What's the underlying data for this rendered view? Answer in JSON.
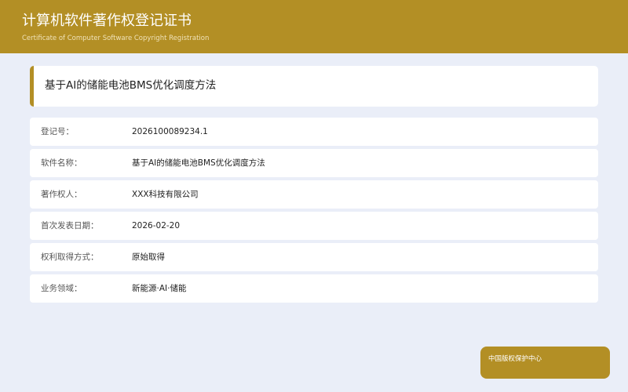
{
  "header": {
    "title": "计算机软件著作权登记证书",
    "subtitle": "Certificate of Computer Software Copyright Registration"
  },
  "document": {
    "title": "基于AI的储能电池BMS优化调度方法"
  },
  "fields": [
    {
      "label": "登记号：",
      "value": "2026100089234.1"
    },
    {
      "label": "软件名称：",
      "value": "基于AI的储能电池BMS优化调度方法"
    },
    {
      "label": "著作权人：",
      "value": "XXX科技有限公司"
    },
    {
      "label": "首次发表日期：",
      "value": "2026-02-20"
    },
    {
      "label": "权利取得方式：",
      "value": "原始取得"
    },
    {
      "label": "业务领域：",
      "value": "新能源·AI·储能"
    }
  ],
  "stamp": {
    "text": "中国版权保护中心"
  },
  "colors": {
    "brand": "#b38f25",
    "background": "#eaeef8",
    "card": "#ffffff"
  }
}
